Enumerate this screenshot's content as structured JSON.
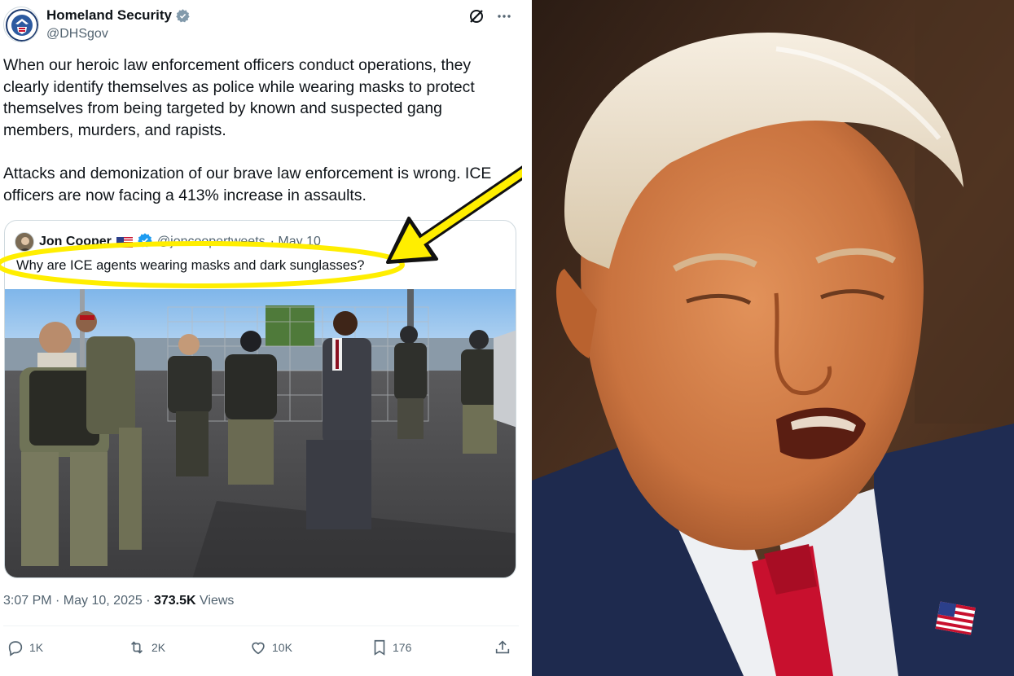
{
  "tweet": {
    "author_name": "Homeland Security",
    "author_handle": "@DHSgov",
    "paragraph_1": "When our heroic law enforcement officers conduct operations, they clearly identify themselves as police while wearing masks to protect themselves from being targeted by known and suspected gang members, murders, and rapists.",
    "paragraph_2": "Attacks and demonization of our brave law enforcement is wrong. ICE officers are now facing a 413% increase in assaults.",
    "timestamp": "3:07 PM · May 10, 2025 · ",
    "views_count": "373.5K",
    "views_label": " Views",
    "replies": "1K",
    "reposts": "2K",
    "likes": "10K",
    "bookmarks": "176"
  },
  "quote": {
    "author_name": "Jon Cooper",
    "author_handle": "@joncoopertweets",
    "date": "· May 10",
    "text": "Why are ICE agents wearing masks and dark sunglasses?"
  },
  "colors": {
    "verified_blue": "#1d9bf0",
    "gov_badge_gray": "#829aab",
    "annotation_yellow": "#ffee00",
    "secondary_text": "#536471"
  },
  "icons": [
    "gov-verified-badge",
    "grok-icon",
    "more-icon",
    "verified-badge",
    "us-flag-emoji",
    "reply-icon",
    "repost-icon",
    "like-icon",
    "bookmark-icon",
    "share-icon"
  ]
}
